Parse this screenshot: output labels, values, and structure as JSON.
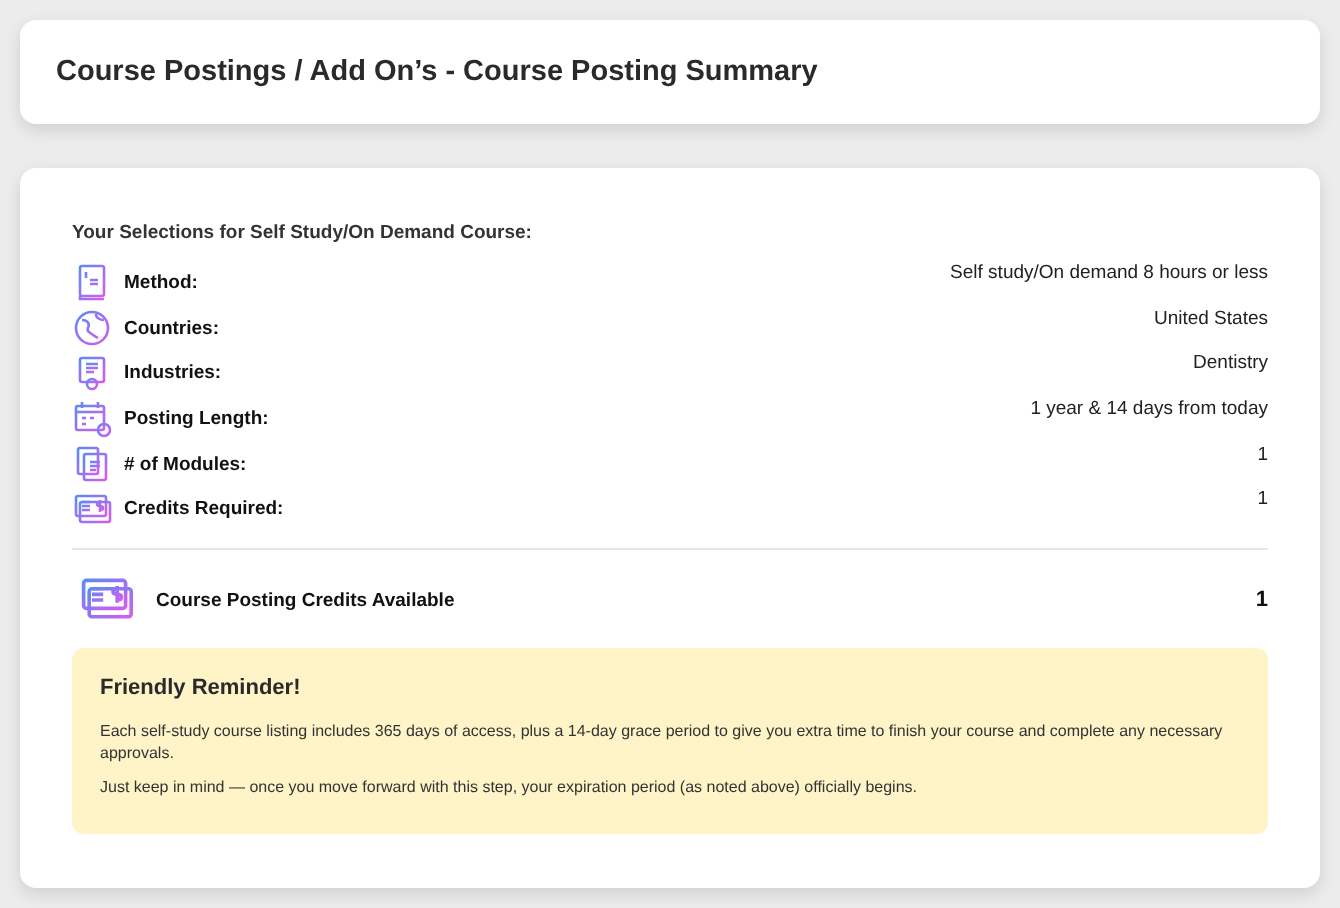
{
  "header": {
    "title": "Course Postings / Add On’s - Course Posting Summary"
  },
  "summary": {
    "heading": "Your Selections for Self Study/On Demand Course:",
    "rows": [
      {
        "label": "Method:",
        "value": "Self study/On demand 8 hours or less"
      },
      {
        "label": "Countries:",
        "value": "United States"
      },
      {
        "label": "Industries:",
        "value": "Dentistry"
      },
      {
        "label": "Posting Length:",
        "value": "1 year & 14 days from today"
      },
      {
        "label": "# of Modules:",
        "value": "1"
      },
      {
        "label": "Credits Required:",
        "value": "1"
      }
    ],
    "credits": {
      "label": "Course Posting Credits Available",
      "value": "1"
    },
    "reminder": {
      "title": "Friendly Reminder!",
      "paragraphs": [
        "Each self-study course listing includes 365 days of access, plus a 14-day grace period to give you extra time to finish your course and complete any necessary approvals.",
        "Just keep in mind — once you move forward with this step, your expiration period (as noted above) officially begins."
      ]
    }
  }
}
